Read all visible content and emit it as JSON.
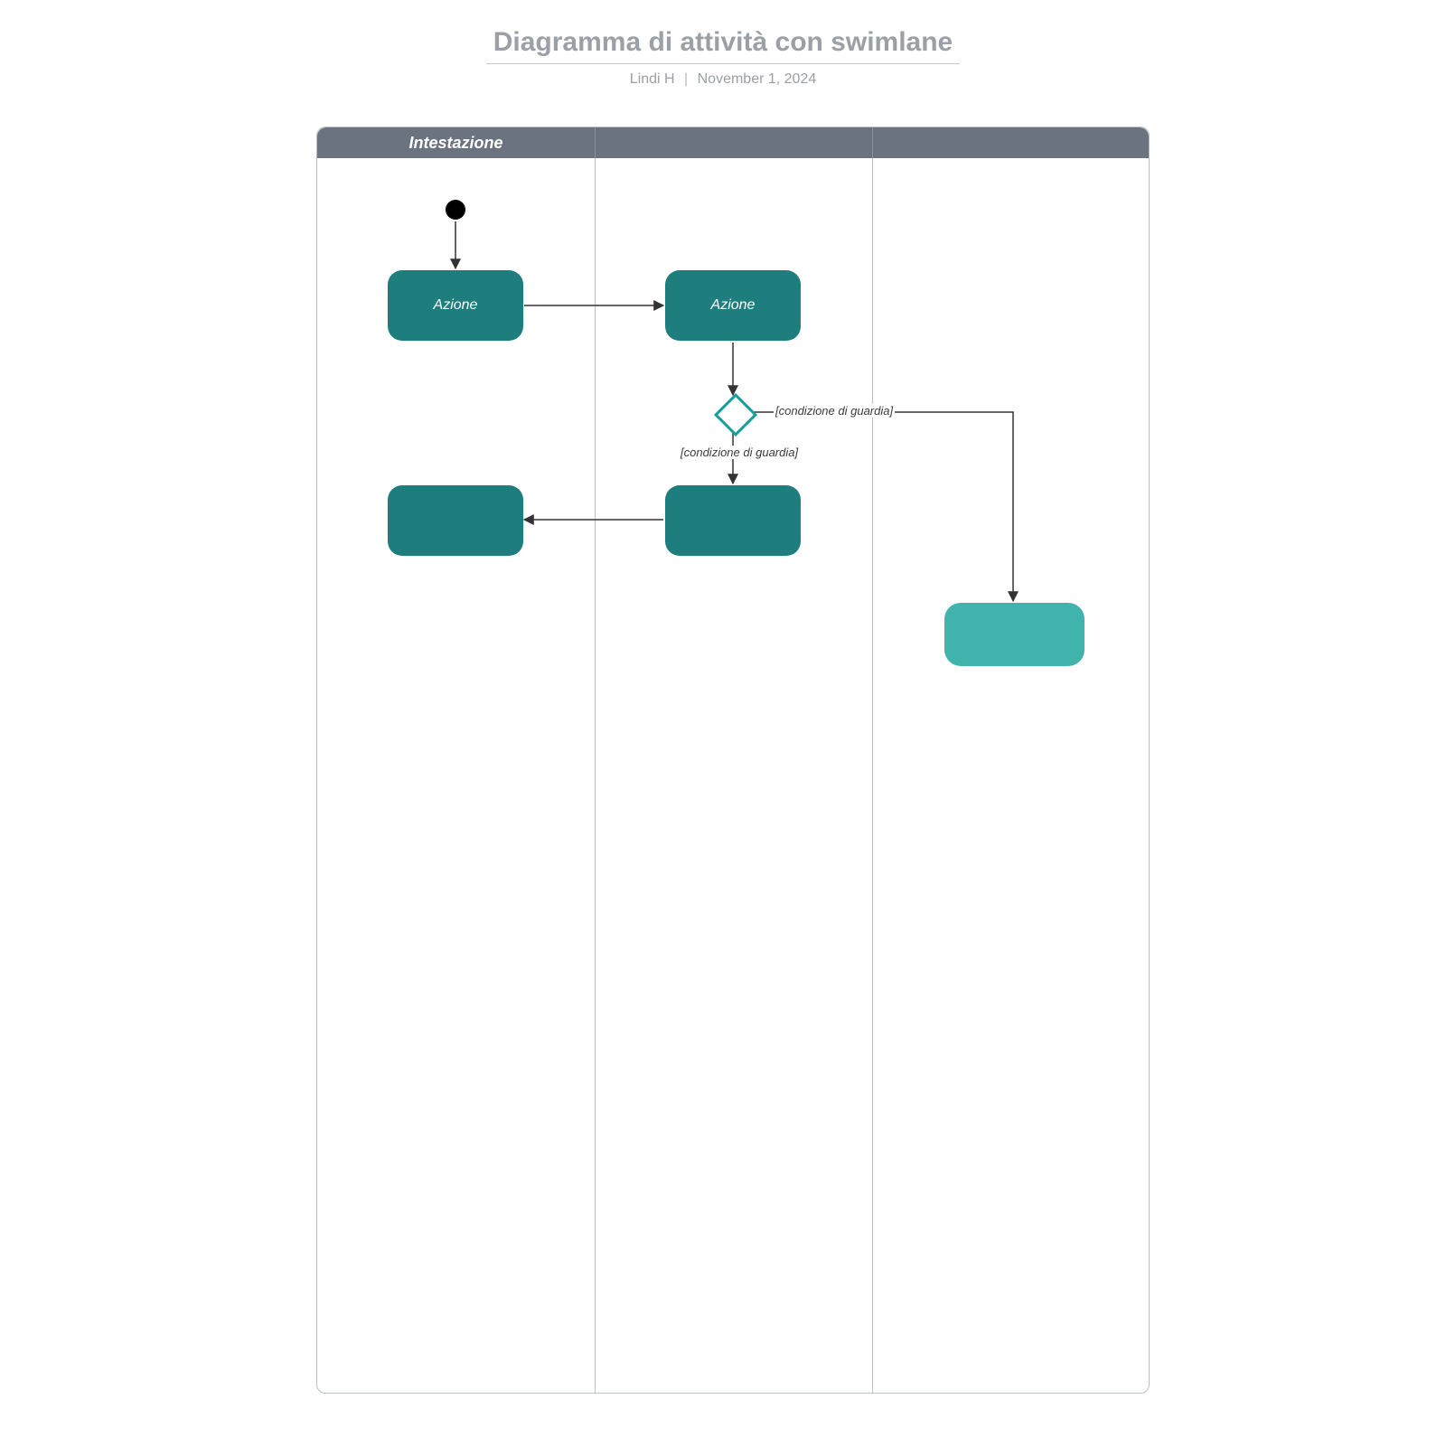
{
  "title": "Diagramma di attività con swimlane",
  "author": "Lindi H",
  "date": "November 1, 2024",
  "swimlane_header": "Intestazione",
  "nodes": {
    "action1": "Azione",
    "action2": "Azione",
    "action3": "",
    "action4": "",
    "action5": ""
  },
  "guards": {
    "right": "[condizione di guardia]",
    "down": "[condizione di guardia]"
  }
}
